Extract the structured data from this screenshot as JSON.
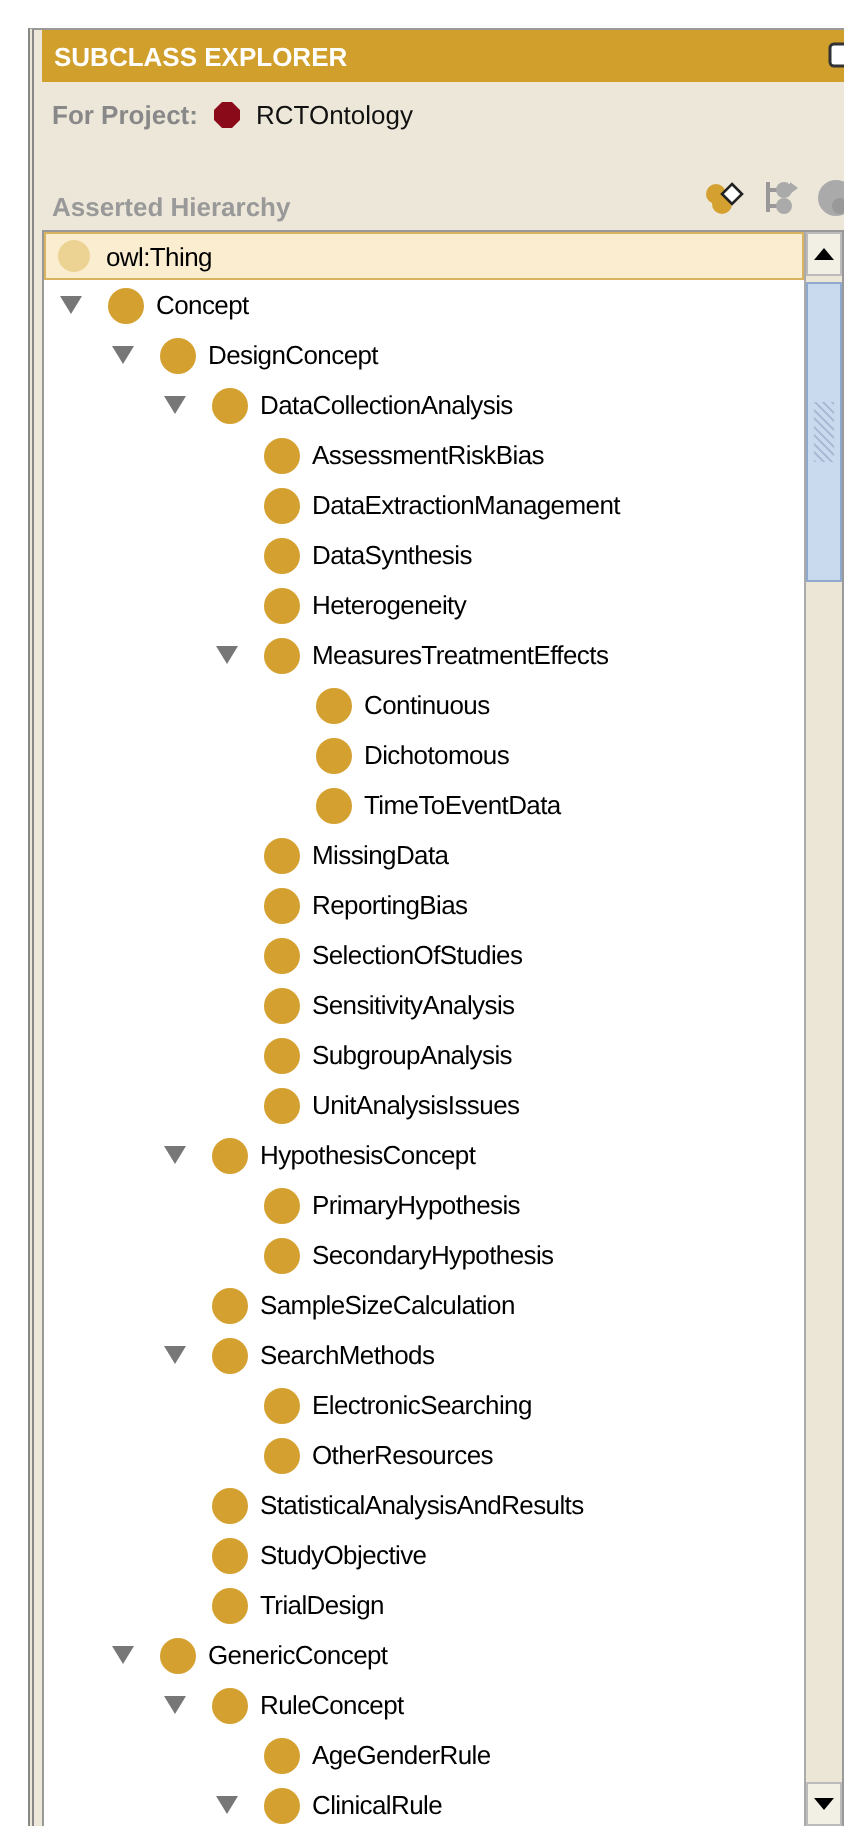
{
  "panel": {
    "title": "SUBCLASS EXPLORER",
    "project_label": "For Project:",
    "project_name": "RCTOntology",
    "hierarchy_label": "Asserted Hierarchy"
  },
  "root": {
    "label": "owl:Thing",
    "selected": true
  },
  "tree": [
    {
      "label": "Concept",
      "selected": false,
      "expanded": true,
      "children": [
        {
          "label": "DesignConcept",
          "selected": false,
          "expanded": true,
          "children": [
            {
              "label": "DataCollectionAnalysis",
              "selected": false,
              "expanded": true,
              "children": [
                {
                  "label": "AssessmentRiskBias",
                  "selected": false
                },
                {
                  "label": "DataExtractionManagement",
                  "selected": false
                },
                {
                  "label": "DataSynthesis",
                  "selected": false
                },
                {
                  "label": "Heterogeneity",
                  "selected": false
                },
                {
                  "label": "MeasuresTreatmentEffects",
                  "selected": false,
                  "expanded": true,
                  "children": [
                    {
                      "label": "Continuous",
                      "selected": false
                    },
                    {
                      "label": "Dichotomous",
                      "selected": false
                    },
                    {
                      "label": "TimeToEventData",
                      "selected": false
                    }
                  ]
                },
                {
                  "label": "MissingData",
                  "selected": false
                },
                {
                  "label": "ReportingBias",
                  "selected": false
                },
                {
                  "label": "SelectionOfStudies",
                  "selected": false
                },
                {
                  "label": "SensitivityAnalysis",
                  "selected": false
                },
                {
                  "label": "SubgroupAnalysis",
                  "selected": false
                },
                {
                  "label": "UnitAnalysisIssues",
                  "selected": false
                }
              ]
            },
            {
              "label": "HypothesisConcept",
              "selected": false,
              "expanded": true,
              "children": [
                {
                  "label": "PrimaryHypothesis",
                  "selected": false
                },
                {
                  "label": "SecondaryHypothesis",
                  "selected": false
                }
              ]
            },
            {
              "label": "SampleSizeCalculation",
              "selected": false
            },
            {
              "label": "SearchMethods",
              "selected": false,
              "expanded": true,
              "children": [
                {
                  "label": "ElectronicSearching",
                  "selected": false
                },
                {
                  "label": "OtherResources",
                  "selected": false
                }
              ]
            },
            {
              "label": "StatisticalAnalysisAndResults",
              "selected": false
            },
            {
              "label": "StudyObjective",
              "selected": false
            },
            {
              "label": "TrialDesign",
              "selected": false
            }
          ]
        },
        {
          "label": "GenericConcept",
          "selected": false,
          "expanded": true,
          "children": [
            {
              "label": "RuleConcept",
              "selected": false,
              "expanded": true,
              "children": [
                {
                  "label": "AgeGenderRule",
                  "selected": false
                },
                {
                  "label": "ClinicalRule",
                  "selected": false,
                  "expanded": true
                }
              ]
            }
          ]
        }
      ]
    }
  ]
}
